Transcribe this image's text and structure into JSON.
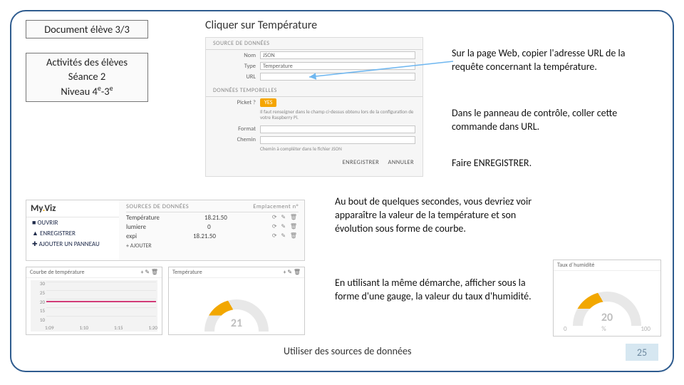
{
  "doc_title": "Document élève 3/3",
  "subtitle_l1": "Activités des élèves",
  "subtitle_l2": "Séance 2",
  "subtitle_l3_a": "Niveau 4",
  "subtitle_l3_b": "-3",
  "sup_e": "e",
  "heading": "Cliquer sur Température",
  "form": {
    "sect1": "SOURCE DE DONNÉES",
    "lbl_nom": "Nom",
    "val_nom": "JSON",
    "lbl_type": "Type",
    "val_type": "Temperature",
    "lbl_url": "URL",
    "sect2": "DONNÉES TEMPORELLES",
    "lbl_picket": "Picket ?",
    "yes": "YES",
    "help": "Il faut renseigner dans le champ ci-dessus obtenu lors de la configuration de votre Raspberry Pi.",
    "lbl_format": "Format",
    "lbl_chemin": "Chemin",
    "help2": "Chemin à compléter dans le fichier JSON",
    "btn_save": "ENREGISTRER",
    "btn_cancel": "ANNULER"
  },
  "t1": "Sur la page Web, copier l'adresse URL de la requête concernant la température.",
  "t2": "Dans le panneau de contrôle, coller cette commande dans URL.",
  "t3": "Faire ENREGISTRER.",
  "t4": "Au bout de quelques secondes, vous devriez voir apparaître la valeur de la température et son évolution sous forme de courbe.",
  "t5": "En utilisant la même démarche, afficher sous la forme d'une gauge, la valeur du taux d'humidité.",
  "footer": "Utiliser des sources de données",
  "page_num": "25",
  "myviz": {
    "logo_a": "My",
    "logo_b": "Viz",
    "open": "■ OUVRIR",
    "save": "▲ ENREGISTRER",
    "add": "✚ AJOUTER UN PANNEAU",
    "hd": "SOURCES DE DONNÉES",
    "hd2": "Emplacement n°",
    "rows": [
      {
        "name": "Température",
        "val": "18.21.50"
      },
      {
        "name": "lumiere",
        "val": "0"
      },
      {
        "name": "expi",
        "val": "18.21.50"
      }
    ],
    "addsrc": "+ AJOUTER"
  },
  "thumb_a_title": "Courbe de température",
  "thumb_b_title": "Température",
  "humid_title": "Taux d´humidité",
  "chart_data": {
    "type": "line",
    "title": "Courbe de température",
    "y_ticks": [
      30,
      25,
      20,
      15,
      10
    ],
    "x_ticks": [
      "1:09",
      "1:10",
      "1:15",
      "1:20"
    ],
    "series": [
      {
        "name": "Température",
        "values": [
          20,
          20,
          20,
          20
        ]
      }
    ],
    "ylim": [
      10,
      30
    ]
  },
  "gauge_temp": {
    "type": "gauge",
    "title": "Température",
    "value": 21,
    "min": 0,
    "max": 100
  },
  "gauge_humid": {
    "type": "gauge",
    "title": "Taux d'humidité",
    "value": 20,
    "min": 0,
    "max": 100
  }
}
